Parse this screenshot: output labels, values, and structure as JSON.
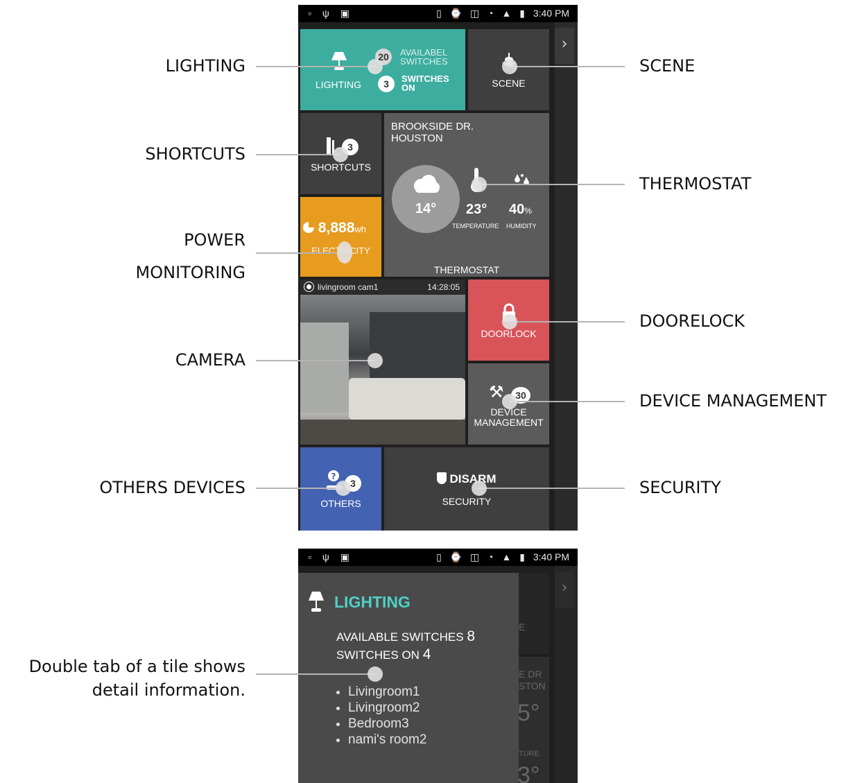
{
  "callouts": {
    "lighting": "LIGHTING",
    "shortcuts": "SHORTCUTS",
    "power_1": "POWER",
    "power_2": "MONITORING",
    "camera": "CAMERA",
    "others": "OTHERS DEVICES",
    "scene": "SCENE",
    "thermostat": "THERMOSTAT",
    "doorlock": "DOORELOCK",
    "device_mgmt": "DEVICE MANAGEMENT",
    "security": "SECURITY",
    "detail_1": "Double tab of a tile shows",
    "detail_2": "detail information."
  },
  "status_bar": {
    "time": "3:40 PM"
  },
  "tiles": {
    "lighting": {
      "label": "LIGHTING",
      "available_count": "20",
      "available_1": "AVAILABEL",
      "available_2": "SWITCHES",
      "on_count": "3",
      "on_1": "SWITCHES",
      "on_2": "ON"
    },
    "scene": {
      "label": "SCENE"
    },
    "shortcuts": {
      "label": "SHORTCUTS",
      "count": "3"
    },
    "thermostat": {
      "address_1": "BROOKSIDE DR.",
      "address_2": "HOUSTON",
      "outdoor": "14°",
      "temperature": "23°",
      "humidity": "40",
      "humidity_unit": "%",
      "temperature_label": "TEMPERATURE",
      "humidity_label": "HUMIDITY",
      "label": "THERMOSTAT"
    },
    "electricity": {
      "value": "8,888",
      "unit": "wh",
      "label": "ELECTRICITY"
    },
    "camera": {
      "name": "livingroom cam1",
      "time": "14:28:05"
    },
    "doorlock": {
      "label": "DOORLOCK"
    },
    "device": {
      "count": "30",
      "label_1": "DEVICE",
      "label_2": "MANAGEMENT"
    },
    "others": {
      "label": "OTHERS",
      "count": "3"
    },
    "security": {
      "state": "DISARM",
      "label": "SECURITY"
    }
  },
  "detail": {
    "title": "LIGHTING",
    "available_label": "AVAILABLE SWITCHES",
    "available_value": "8",
    "on_label": "SWITCHES ON",
    "on_value": "4",
    "rooms": [
      "Livingroom1",
      "Livingroom2",
      "Bedroom3",
      "nami's room2"
    ],
    "bg_fragments": {
      "e": "E",
      "edr": "E DR",
      "ston": "STON",
      "deg": "5°",
      "ture": "TURE",
      "deg2": "3°"
    }
  },
  "colors": {
    "teal": "#3dada0",
    "orange": "#e79b1f",
    "red": "#d95459",
    "blue": "#4462b2",
    "dark": "#3f3f3f"
  }
}
